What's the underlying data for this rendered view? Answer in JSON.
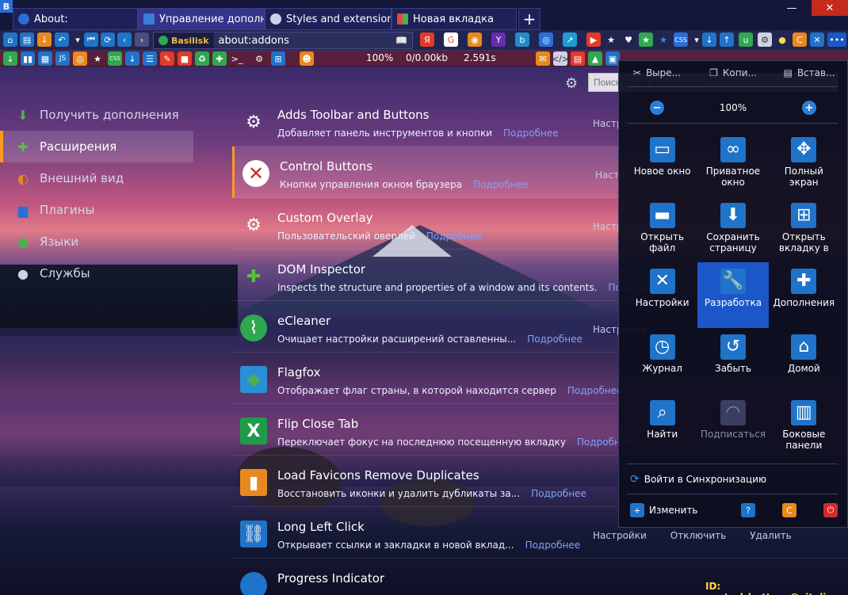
{
  "window": {
    "logo": "B",
    "min": "—",
    "max": "☐",
    "close": "✕"
  },
  "tabs": [
    {
      "label": "About:",
      "icon": "chrome-icon",
      "color": "#2b6fd6"
    },
    {
      "label": "Управление дополнени",
      "icon": "puzzle-icon",
      "color": "#3a7dd6"
    },
    {
      "label": "Styles and extensions fo",
      "icon": "gear-icon",
      "color": "#cfd2e6"
    },
    {
      "label": "Новая вкладка",
      "icon": "windows-icon",
      "color": "#e04a3a"
    }
  ],
  "newtab": "+",
  "nav": {
    "identity": "Basilisk",
    "url": "about:addons"
  },
  "status": {
    "zoom": "100%",
    "speed": "0/0.00kb",
    "time": "2.591s"
  },
  "search": {
    "placeholder": "Поиск среди дополнений"
  },
  "categories": [
    {
      "label": "Получить дополнения",
      "icon": "download-icon"
    },
    {
      "label": "Расширения",
      "icon": "puzzle-icon"
    },
    {
      "label": "Внешний вид",
      "icon": "palette-icon"
    },
    {
      "label": "Плагины",
      "icon": "lego-icon"
    },
    {
      "label": "Языки",
      "icon": "globe-icon"
    },
    {
      "label": "Службы",
      "icon": "chat-icon"
    }
  ],
  "addons": [
    {
      "name": "Adds Toolbar and Buttons",
      "desc": "Добавляет панель инструментов и кнопки",
      "more": "Подробнее",
      "icon": "gear-icon"
    },
    {
      "name": "Control Buttons",
      "desc": "Кнопки управления окном браузера",
      "more": "Подробнее",
      "icon": "close-circle-icon"
    },
    {
      "name": "Custom Overlay",
      "desc": "Пользовательский оверлей",
      "more": "Подробнее",
      "icon": "gear-icon"
    },
    {
      "name": "DOM Inspector",
      "desc": "Inspects the structure and properties of a window and its contents.",
      "more": "Подробнее",
      "icon": "puzzle-icon"
    },
    {
      "name": "eCleaner",
      "desc": "Очищает настройки расширений оставленны...",
      "more": "Подробнее",
      "icon": "broom-icon"
    },
    {
      "name": "Flagfox",
      "desc": "Отображает флаг страны, в которой находится сервер",
      "more": "Подробнее",
      "icon": "flag-icon"
    },
    {
      "name": "Flip Close Tab",
      "desc": "Переключает фокус на последнюю посещенную вкладку",
      "more": "Подробнее",
      "icon": "excel-x-icon"
    },
    {
      "name": "Load Favicons Remove Duplicates",
      "desc": "Восстановить иконки и удалить дубликаты за...",
      "more": "Подробнее",
      "icon": "bookmark-icon"
    },
    {
      "name": "Long Left Click",
      "desc": "Открывает ссылки и закладки в новой вклад...",
      "more": "Подробнее",
      "icon": "link-icon"
    },
    {
      "name": "Progress Indicator",
      "desc": "",
      "more": "",
      "icon": "circle-icon"
    }
  ],
  "addon_actions": {
    "settings": "Настройки",
    "disable": "Отключить",
    "remove": "Удалить"
  },
  "menu": {
    "cut": "Выре...",
    "copy": "Копи...",
    "paste": "Встав...",
    "zoom_out": "−",
    "zoom": "100%",
    "zoom_in": "+",
    "items": [
      {
        "label": "Новое окно",
        "icon": "window-icon"
      },
      {
        "label": "Приватное окно",
        "icon": "mask-icon"
      },
      {
        "label": "Полный экран",
        "icon": "fullscreen-icon"
      },
      {
        "label": "Открыть файл",
        "icon": "folder-icon"
      },
      {
        "label": "Сохранить страницу",
        "icon": "save-icon"
      },
      {
        "label": "Открыть вкладку в",
        "icon": "grid-plus-icon"
      },
      {
        "label": "Настройки",
        "icon": "tools-icon"
      },
      {
        "label": "Разработка",
        "icon": "wrench-icon"
      },
      {
        "label": "Дополнения",
        "icon": "puzzle-icon"
      },
      {
        "label": "Журнал",
        "icon": "clock-icon"
      },
      {
        "label": "Забыть",
        "icon": "history-icon"
      },
      {
        "label": "Домой",
        "icon": "home-icon"
      },
      {
        "label": "Найти",
        "icon": "search-icon"
      },
      {
        "label": "Подписаться",
        "icon": "rss-icon"
      },
      {
        "label": "Боковые панели",
        "icon": "sidebar-icon"
      }
    ],
    "sync": "Войти в Синхронизацию",
    "customize": "Изменить"
  },
  "footer_id": "ID: control_buttons@vitaliy.ru"
}
